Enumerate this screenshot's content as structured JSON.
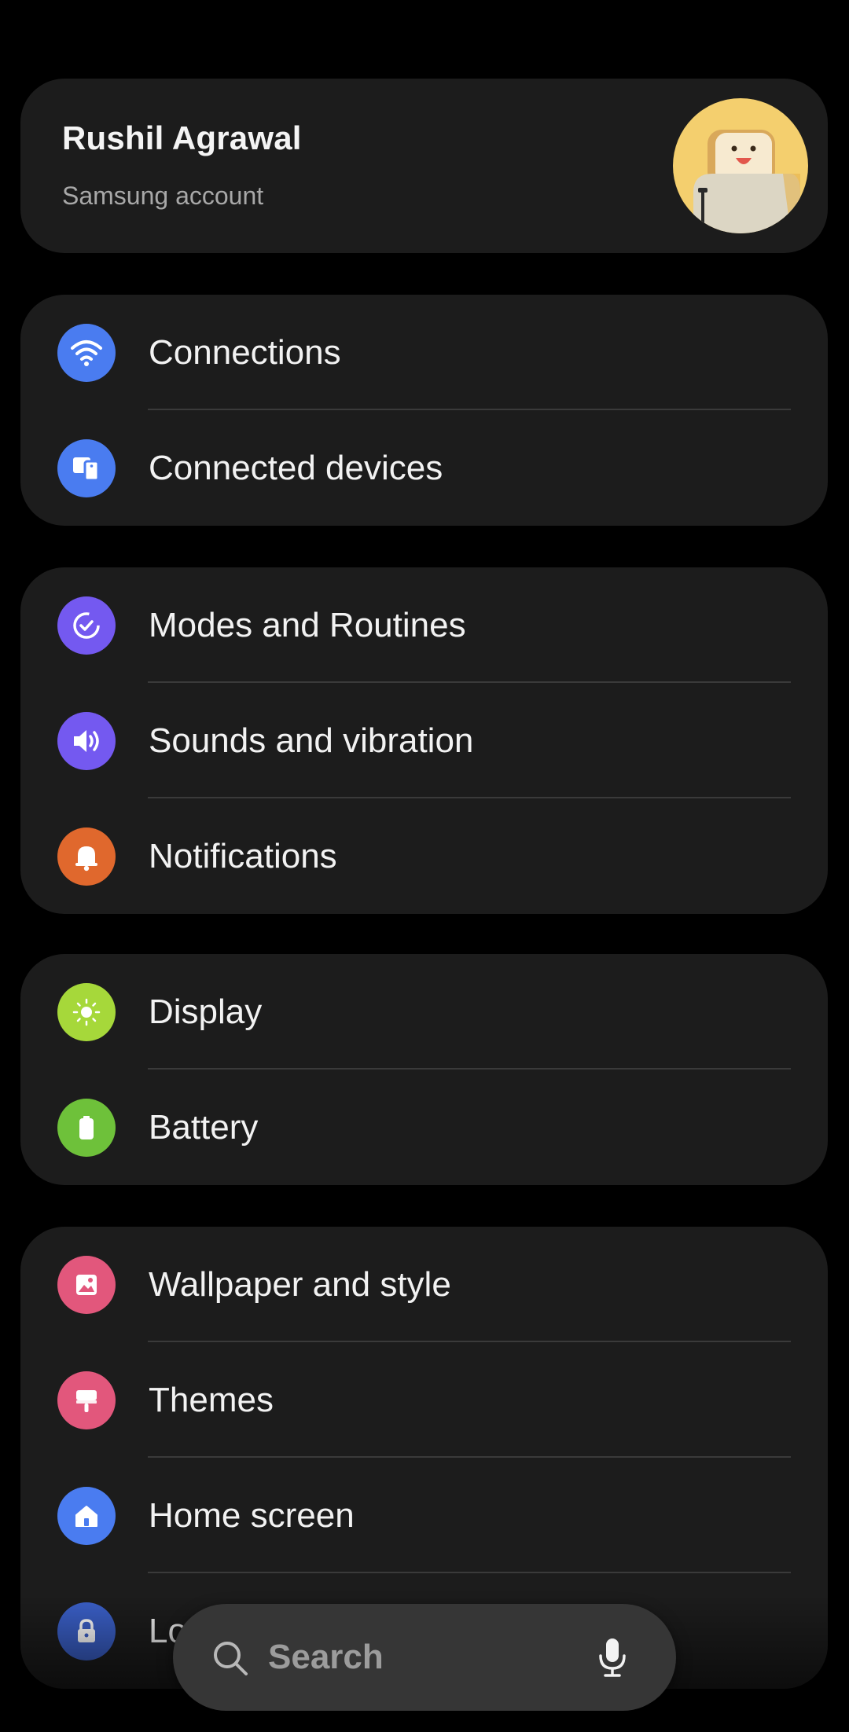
{
  "account": {
    "name": "Rushil Agrawal",
    "subtitle": "Samsung account"
  },
  "groups": [
    {
      "items": [
        {
          "label": "Connections",
          "icon": "wifi-icon",
          "color": "#4a7cf0"
        },
        {
          "label": "Connected devices",
          "icon": "devices-icon",
          "color": "#4a7cf0"
        }
      ]
    },
    {
      "items": [
        {
          "label": "Modes and Routines",
          "icon": "routine-check-icon",
          "color": "#7459f0"
        },
        {
          "label": "Sounds and vibration",
          "icon": "speaker-icon",
          "color": "#7459f0"
        },
        {
          "label": "Notifications",
          "icon": "bell-icon",
          "color": "#e0682d"
        }
      ]
    },
    {
      "items": [
        {
          "label": "Display",
          "icon": "sun-icon",
          "color": "#a6d83a"
        },
        {
          "label": "Battery",
          "icon": "battery-icon",
          "color": "#6ec13a"
        }
      ]
    },
    {
      "items": [
        {
          "label": "Wallpaper and style",
          "icon": "image-icon",
          "color": "#e2577c"
        },
        {
          "label": "Themes",
          "icon": "paintbrush-icon",
          "color": "#e2577c"
        },
        {
          "label": "Home screen",
          "icon": "home-icon",
          "color": "#4a7cf0"
        },
        {
          "label": "Lock screen",
          "icon": "lock-icon",
          "color": "#3a5fc7"
        }
      ]
    }
  ],
  "search": {
    "placeholder": "Search"
  }
}
